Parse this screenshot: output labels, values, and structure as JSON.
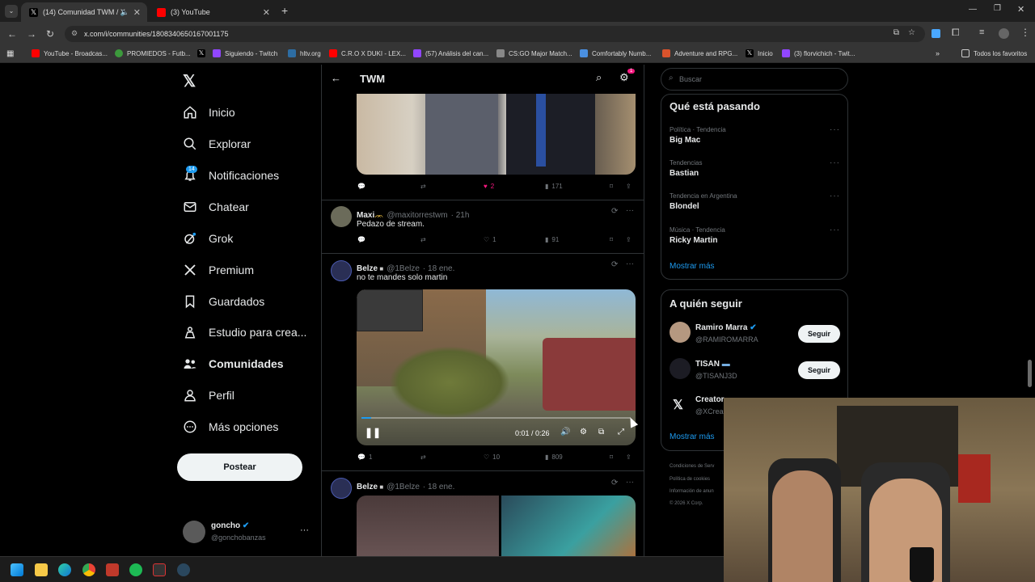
{
  "browser": {
    "tabs": [
      {
        "label": "(14) Comunidad TWM / X",
        "active": true
      },
      {
        "label": "(3) YouTube",
        "active": false
      }
    ],
    "url": "x.com/i/communities/1808340650167001175",
    "bookmarks": [
      "YouTube - Broadcas...",
      "PROMIEDOS - Futb...",
      "",
      "Siguiendo - Twitch",
      "hltv.org",
      "C.R.O X DUKI - LEX...",
      "(57) Análisis del can...",
      "CS:GO Major Match...",
      "Comfortably Numb...",
      "Adventure and RPG...",
      "Inicio",
      "(3) florvichich - Twit..."
    ],
    "all_bookmarks": "Todos los favoritos"
  },
  "nav": {
    "items": [
      {
        "label": "Inicio"
      },
      {
        "label": "Explorar"
      },
      {
        "label": "Notificaciones",
        "badge": "14"
      },
      {
        "label": "Chatear"
      },
      {
        "label": "Grok"
      },
      {
        "label": "Premium"
      },
      {
        "label": "Guardados"
      },
      {
        "label": "Estudio para crea..."
      },
      {
        "label": "Comunidades"
      },
      {
        "label": "Perfil"
      },
      {
        "label": "Más opciones"
      }
    ],
    "post_label": "Postear",
    "account": {
      "name": "goncho",
      "handle": "@gonchobanzas"
    }
  },
  "header": {
    "title": "TWM",
    "settings_badge": "1"
  },
  "tweets": [
    {
      "stats": {
        "replies": "",
        "retweets": "",
        "likes": "2",
        "views": "171"
      }
    },
    {
      "name": "Maxi",
      "handle": "@maxitorrestwm",
      "time": "· 21h",
      "text": "Pedazo de stream.",
      "stats": {
        "replies": "",
        "retweets": "",
        "likes": "1",
        "views": "91"
      }
    },
    {
      "name": "Belze",
      "handle": "@1Belze",
      "time": "· 18 ene.",
      "text": "no te mandes solo martin",
      "video_time": "0:01 / 0:26",
      "stats": {
        "replies": "1",
        "retweets": "",
        "likes": "10",
        "views": "809"
      }
    },
    {
      "name": "Belze",
      "handle": "@1Belze",
      "time": "· 18 ene."
    }
  ],
  "search": {
    "placeholder": "Buscar"
  },
  "trends": {
    "title": "Qué está pasando",
    "items": [
      {
        "meta": "Política · Tendencia",
        "name": "Big Mac"
      },
      {
        "meta": "Tendencias",
        "name": "Bastian"
      },
      {
        "meta": "Tendencia en Argentina",
        "name": "Blondel"
      },
      {
        "meta": "Música · Tendencia",
        "name": "Ricky Martin"
      }
    ],
    "show_more": "Mostrar más"
  },
  "who_to_follow": {
    "title": "A quién seguir",
    "items": [
      {
        "name": "Ramiro Marra",
        "handle": "@RAMIROMARRA"
      },
      {
        "name": "TISAN",
        "handle": "@TISANJ3D"
      },
      {
        "name": "Creator",
        "handle": "@XCrea"
      }
    ],
    "follow_label": "Seguir",
    "show_more": "Mostrar más"
  },
  "footer": {
    "links": [
      "Condiciones de Serv",
      "Política de cookies",
      "Información de anun",
      "© 2026 X Corp."
    ]
  }
}
